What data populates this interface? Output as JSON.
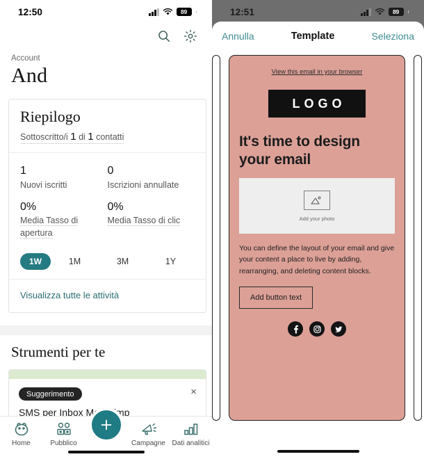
{
  "left": {
    "status": {
      "time": "12:50",
      "battery": "89"
    },
    "top_icons": {
      "search": "search-icon",
      "settings": "gear-icon"
    },
    "account_label": "Account",
    "account_name": "And",
    "summary": {
      "title": "Riepilogo",
      "subtitle_prefix": "Sottoscritto/i ",
      "subtitle_num1": "1",
      "subtitle_mid": " di ",
      "subtitle_num2": "1",
      "subtitle_suffix": " contatti",
      "stats": [
        {
          "value": "1",
          "label": "Nuovi iscritti",
          "dotted": false
        },
        {
          "value": "0",
          "label": "Iscrizioni annullate",
          "dotted": false
        },
        {
          "value": "0%",
          "label": "Media Tasso di apertura",
          "dotted": true
        },
        {
          "value": "0%",
          "label": "Media Tasso di clic",
          "dotted": true
        }
      ],
      "ranges": [
        {
          "label": "1W",
          "active": true
        },
        {
          "label": "1M",
          "active": false
        },
        {
          "label": "3M",
          "active": false
        },
        {
          "label": "1Y",
          "active": false
        }
      ],
      "footer_link": "Visualizza tutte le attività"
    },
    "tools": {
      "section_title": "Strumenti per te",
      "badge": "Suggerimento",
      "tip_text": "SMS per Inbox Mailchimp",
      "close": "×"
    },
    "tabbar": [
      {
        "label": "Home",
        "icon": "mailchimp-freddie-icon"
      },
      {
        "label": "Pubblico",
        "icon": "audience-icon"
      },
      {
        "label": "Campagne",
        "icon": "megaphone-icon"
      },
      {
        "label": "Dati analitici",
        "icon": "bar-chart-icon"
      }
    ],
    "fab": {
      "icon": "plus-icon"
    },
    "colors": {
      "teal": "#257b82",
      "fab_teal": "#1f7b84",
      "banner_green": "#dcead0"
    }
  },
  "right": {
    "status": {
      "time": "12:51",
      "battery": "89"
    },
    "nav": {
      "cancel": "Annulla",
      "title": "Template",
      "select": "Seleziona"
    },
    "template": {
      "view_link": "View this email in your browser",
      "logo": "LOGO",
      "headline": "It's time to design your email",
      "photo_caption": "Add your photo",
      "body": "You can define the layout of your email and give your content a place to live by adding, rearranging, and deleting content blocks.",
      "button": "Add button text",
      "social": [
        "facebook-icon",
        "instagram-icon",
        "twitter-icon"
      ],
      "bg_color": "#dca097"
    }
  }
}
